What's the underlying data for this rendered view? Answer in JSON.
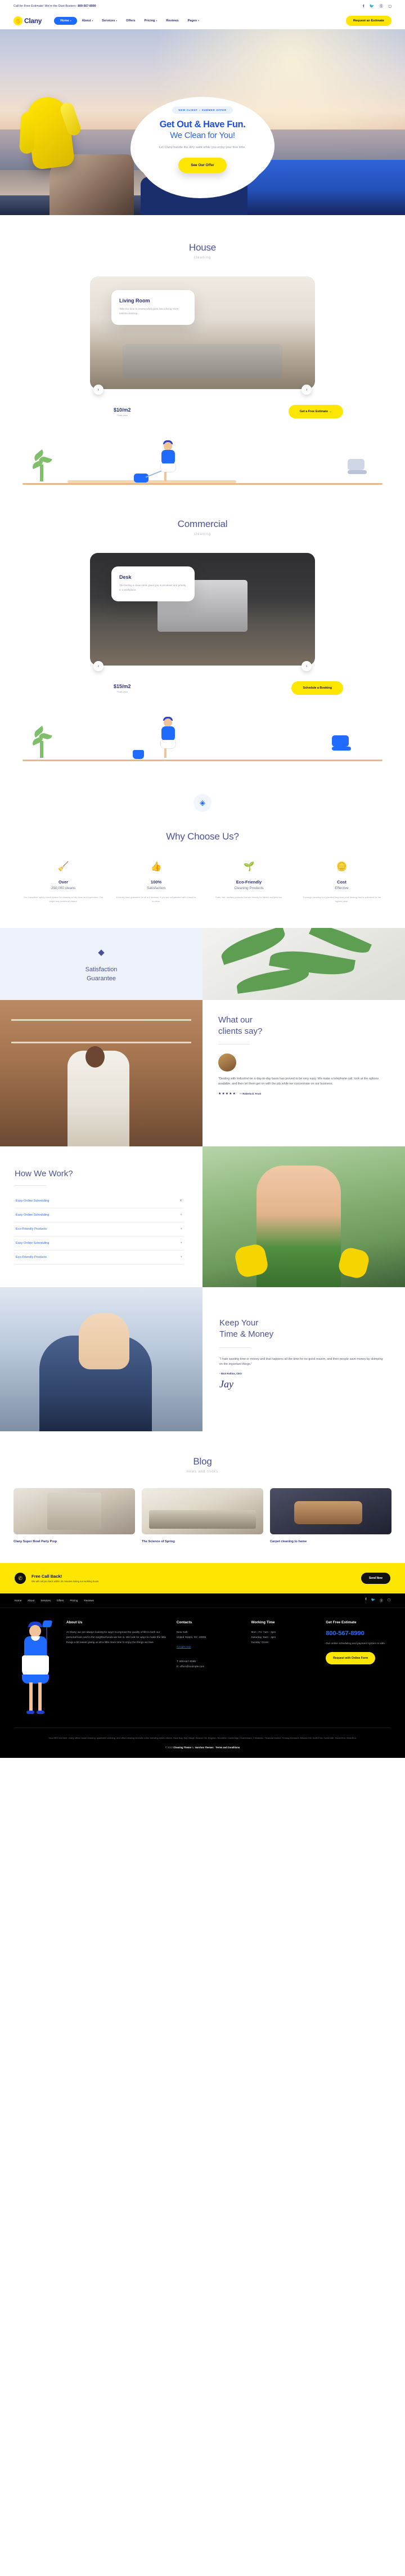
{
  "topbar": {
    "text": "Call for Free Estimate! We're the Dust Busters:",
    "phone": "800-567-8990",
    "social": [
      "f",
      "t",
      "b",
      "i"
    ]
  },
  "nav": {
    "logo": "Clany",
    "logo_icon": "hand-spray-icon",
    "items": [
      {
        "label": "Home",
        "caret": "▾",
        "active": true
      },
      {
        "label": "About",
        "caret": "▾",
        "active": false
      },
      {
        "label": "Services",
        "caret": "▾",
        "active": false
      },
      {
        "label": "Offers",
        "caret": "",
        "active": false
      },
      {
        "label": "Pricing",
        "caret": "▾",
        "active": false
      },
      {
        "label": "Reviews",
        "caret": "",
        "active": false
      },
      {
        "label": "Pages",
        "caret": "▾",
        "active": false
      }
    ],
    "cta": "Request an Estimate"
  },
  "hero": {
    "badge": "NEW CLIENT – SUMMER OFFER",
    "title_line1": "Get Out & Have Fun.",
    "title_line2": "We Clean for You!",
    "subtitle": "Let Clany handle the dirty work while you enjoy your free time.",
    "button": "See Our Offer"
  },
  "house": {
    "title": "House",
    "subtitle": "cleaning",
    "card": {
      "heading": "Living Room",
      "text": "Take the time to review what goes into a living room intense cleanup."
    },
    "price": "$10/m2",
    "price_note": "*Start price",
    "button": "Get a Free Estimate  →",
    "arrow_prev": "‹",
    "arrow_next": "›"
  },
  "commercial": {
    "title": "Commercial",
    "subtitle": "cleaning",
    "card": {
      "heading": "Desk",
      "text": "The feeling a clean desk gives you is priceless and priority in a workplace."
    },
    "price": "$15/m2",
    "price_note": "*Start price",
    "button": "Schedule a Booking",
    "arrow_prev": "‹",
    "arrow_next": "›"
  },
  "why": {
    "divider_icon": "badge-icon",
    "title": "Why Choose Us?",
    "features": [
      {
        "icon": "broom-icon",
        "heading": "Over",
        "sub": "250,000 cleans",
        "text": "Our Clanytitles' safety check system for cleaning is fully done and supervised. Our target fear modelevel cleans."
      },
      {
        "icon": "thumbs-up-icon",
        "heading": "100%",
        "sub": "Satisfaction",
        "text": "A money-back guarantee on all our services. If you are not satisfied with a result to re-clean."
      },
      {
        "icon": "eco-hand-icon",
        "heading": "Eco-Friendly",
        "sub": "Cleaning Products",
        "text": "Safer, fast, sanitary products that are friendly for babies and pets too."
      },
      {
        "icon": "coins-icon",
        "heading": "Cost",
        "sub": "Effective",
        "text": "Thorough cleaning is a specified long-term price strategy that is optimized for the highest value."
      }
    ]
  },
  "satisfaction": {
    "icon": "diamond-shield-icon",
    "line1": "Satisfaction",
    "line2": "Guarantee"
  },
  "testimonial": {
    "title_line1": "What our",
    "title_line2": "clients say?",
    "avatar": "client-avatar",
    "quote": "\"Dealing with Industriel on a day-to-day basis has proved to be very easy. We make a telephone call, look at the options available, and then let them get on with the job while we concentrate on our business.",
    "stars": "★★★★★",
    "author": "—  Roberta D. Frost"
  },
  "how_we_work": {
    "title": "How We Work?",
    "items": [
      {
        "label": "Easy Online Scheduling",
        "icon": "✕"
      },
      {
        "label": "Easy Online Scheduling",
        "icon": "+"
      },
      {
        "label": "Eco-Friendly Products",
        "icon": "+"
      },
      {
        "label": "Easy Online Scheduling",
        "icon": "+"
      },
      {
        "label": "Eco-Friendly Products",
        "icon": "+"
      }
    ]
  },
  "keep": {
    "title_line1": "Keep Your",
    "title_line2": "Time & Money",
    "quote": "\"I hate wasting time or money and that happens all the time for no good reason, and then people save money by skimping on the important things.\"",
    "author": "- Nick Rollins, CEO",
    "signature": "Jay"
  },
  "blog": {
    "title": "Blog",
    "subtitle": "news and tricks",
    "posts": [
      {
        "title": "Clany Super Bowl Party Prep",
        "img": "blog-img-1"
      },
      {
        "title": "The Science of Spring",
        "img": "blog-img-2"
      },
      {
        "title": "Carpet cleaning to home",
        "img": "blog-img-3"
      }
    ]
  },
  "cta": {
    "icon": "phone-icon",
    "heading": "Free Call Back!",
    "sub": "We will call you back within 30 minutes during our working hours",
    "button": "Send Now"
  },
  "footer": {
    "nav": [
      "Home",
      "About",
      "Services",
      "Offers",
      "Pricing",
      "Reviews"
    ],
    "social": [
      "f",
      "t",
      "b",
      "i"
    ],
    "about": {
      "heading": "About Us",
      "text": "At Clany, we are always looking for ways to improve the quality of life in both our personal lives and in the neighborhoods we live in. We look for ways to make the little things a bit easier giving us all a little more time to enjoy the things we love."
    },
    "contacts": {
      "heading": "Contacts",
      "line1": "New York",
      "line2": "United States, NY, 10005",
      "map_link": "Google map",
      "phone": "T: 800-567-8990",
      "email": "E: office@example.com"
    },
    "working": {
      "heading": "Working Time",
      "line1": "Mon - Fri: 7am - 4pm",
      "line2": "Saturday: 8am - 4pm",
      "line3": "Sunday: Close"
    },
    "estimate": {
      "heading": "Get Free Estimate",
      "phone": "800-567-8990",
      "text": "Our online scheduling and payment system is safe.",
      "button": "Request with Online Form"
    },
    "seo": "Your SEO text here. Clany offers house cleaning, apartment cleaning, and office cleaning services in the following areas: Allston, Back Bay, Bay Village, Beacon Hill, Brighton, Brookline, Cambridge, Charlestown, Chinatown, Financial District, Fenway Kenmore, Mission Hill, North End, Somerville, South End, West End.",
    "copyright_pre": "© 2022 ",
    "copyright_brand": "Cleaning Theme",
    "copyright_mid": " by ",
    "copyright_author": "VamTam Themes",
    "copyright_sep": "  ·  ",
    "copyright_terms": "Terms and Conditions"
  },
  "colors": {
    "accent_yellow": "#ffe600",
    "accent_blue": "#1f6bff",
    "navy": "#2b2f7a"
  }
}
